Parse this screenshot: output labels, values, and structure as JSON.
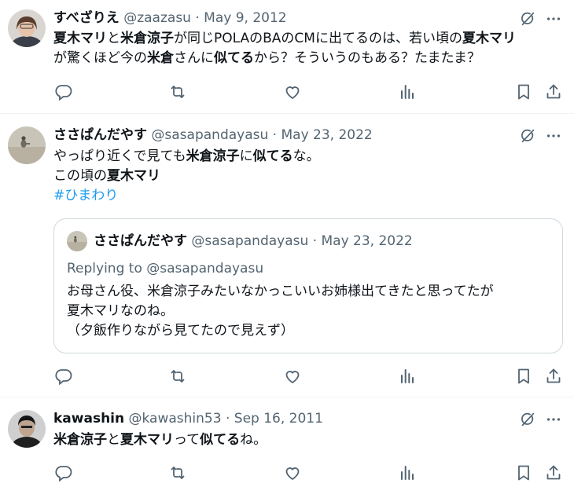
{
  "tweets": [
    {
      "name": "すべざりえ",
      "handle": "@zaazasu",
      "date": "May 9, 2012",
      "line1": [
        "夏木マリ",
        "と",
        "米倉涼子",
        "が同じPOLAのBAのCMに出てるのは、若い頃の",
        "夏木マリ"
      ],
      "line2": [
        "が驚くほど今の",
        "米倉",
        "さんに",
        "似てる",
        "から？そういうのもある？たまたま？"
      ]
    },
    {
      "name": "ささぱんだやす",
      "handle": "@sasapandayasu",
      "date": "May 23, 2022",
      "line1": [
        "やっぱり近くで見ても",
        "米倉涼子",
        "に",
        "似てる",
        "な。"
      ],
      "line2": [
        "この頃の",
        "夏木マリ"
      ],
      "hashtag": "#ひまわり",
      "quote": {
        "name": "ささぱんだやす",
        "handle": "@sasapandayasu",
        "date": "May 23, 2022",
        "replying_prefix": "Replying to ",
        "replying_to": "@sasapandayasu",
        "line1": "お母さん役、米倉涼子みたいなかっこいいお姉様出てきたと思ってたが",
        "line2": "夏木マリなのね。",
        "line3": "（夕飯作りながら見てたので見えず）"
      }
    },
    {
      "name": "kawashin",
      "handle": "@kawashin53",
      "date": "Sep 16, 2011",
      "line1": [
        "米倉涼子",
        "と",
        "夏木マリ",
        "って",
        "似てる",
        "ね。"
      ]
    }
  ],
  "separator": " · ",
  "icons": [
    "reply-icon",
    "retweet-icon",
    "like-icon",
    "views-icon",
    "bookmark-icon",
    "share-icon",
    "grok-icon",
    "more-icon"
  ],
  "colors": {
    "text": "#0f1419",
    "secondary": "#536471",
    "link": "#1d9bf0",
    "border": "#cfd9de"
  }
}
